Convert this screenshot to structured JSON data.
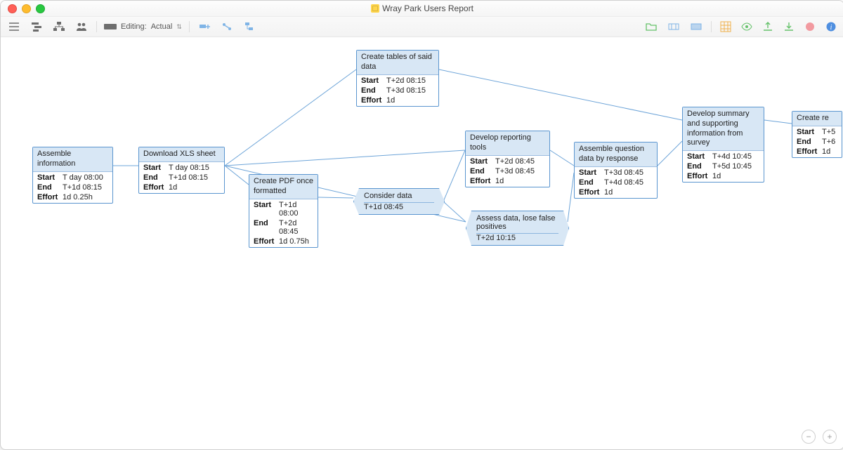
{
  "window": {
    "title": "Wray Park Users Report"
  },
  "toolbar": {
    "editing_label": "Editing:",
    "editing_value": "Actual"
  },
  "labels": {
    "start": "Start",
    "end": "End",
    "effort": "Effort"
  },
  "nodes": {
    "assemble_info": {
      "title": "Assemble information",
      "start": "T day 08:00",
      "end": "T+1d 08:15",
      "effort": "1d 0.25h"
    },
    "download_xls": {
      "title": "Download XLS sheet",
      "start": "T day 08:15",
      "end": "T+1d 08:15",
      "effort": "1d"
    },
    "create_tables": {
      "title": "Create tables of said data",
      "start": "T+2d 08:15",
      "end": "T+3d 08:15",
      "effort": "1d"
    },
    "create_pdf": {
      "title": "Create PDF once formatted",
      "start": "T+1d 08:00",
      "end": "T+2d 08:45",
      "effort": "1d 0.75h"
    },
    "develop_tools": {
      "title": "Develop reporting tools",
      "start": "T+2d 08:45",
      "end": "T+3d 08:45",
      "effort": "1d"
    },
    "assemble_q": {
      "title": "Assemble question data by response",
      "start": "T+3d 08:45",
      "end": "T+4d 08:45",
      "effort": "1d"
    },
    "develop_summary": {
      "title": "Develop summary and supporting information from survey",
      "start": "T+4d 10:45",
      "end": "T+5d 10:45",
      "effort": "1d"
    },
    "create_re": {
      "title": "Create re",
      "start": "T+5",
      "end": "T+6",
      "effort": "1d"
    }
  },
  "milestones": {
    "consider": {
      "title": "Consider data",
      "date": "T+1d 08:45"
    },
    "assess": {
      "title": "Assess data, lose false positives",
      "date": "T+2d 10:15"
    }
  },
  "icons": {
    "outline": "outline-view-icon",
    "gantt": "gantt-view-icon",
    "wbs": "wbs-view-icon",
    "resources": "resources-icon",
    "add_task": "add-task-icon",
    "link": "link-tasks-icon",
    "indent": "indent-icon",
    "folder": "folder-icon",
    "collapse": "collapse-icon",
    "expand": "expand-icon",
    "grid": "grid-icon",
    "eye": "visibility-icon",
    "import": "import-icon",
    "export": "export-icon",
    "stop": "stop-icon",
    "info": "info-icon"
  }
}
